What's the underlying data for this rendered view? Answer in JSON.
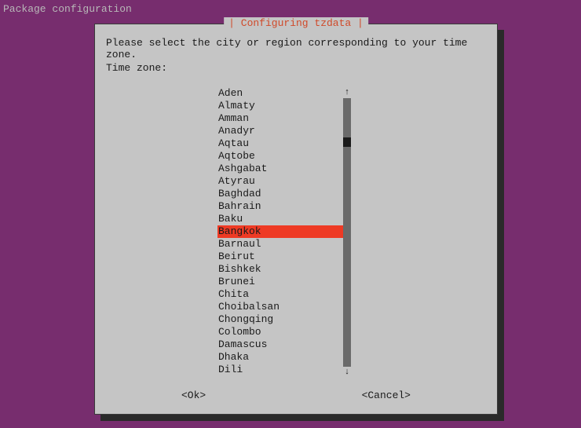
{
  "header": {
    "title": "Package configuration"
  },
  "dialog": {
    "title": "Configuring tzdata",
    "prompt": "Please select the city or region corresponding to your time zone.",
    "label": "Time zone:",
    "selected_index": 11,
    "items": [
      "Aden",
      "Almaty",
      "Amman",
      "Anadyr",
      "Aqtau",
      "Aqtobe",
      "Ashgabat",
      "Atyrau",
      "Baghdad",
      "Bahrain",
      "Baku",
      "Bangkok",
      "Barnaul",
      "Beirut",
      "Bishkek",
      "Brunei",
      "Chita",
      "Choibalsan",
      "Chongqing",
      "Colombo",
      "Damascus",
      "Dhaka",
      "Dili"
    ],
    "buttons": {
      "ok": "<Ok>",
      "cancel": "<Cancel>"
    },
    "scroll": {
      "up_arrow": "↑",
      "down_arrow": "↓"
    }
  }
}
